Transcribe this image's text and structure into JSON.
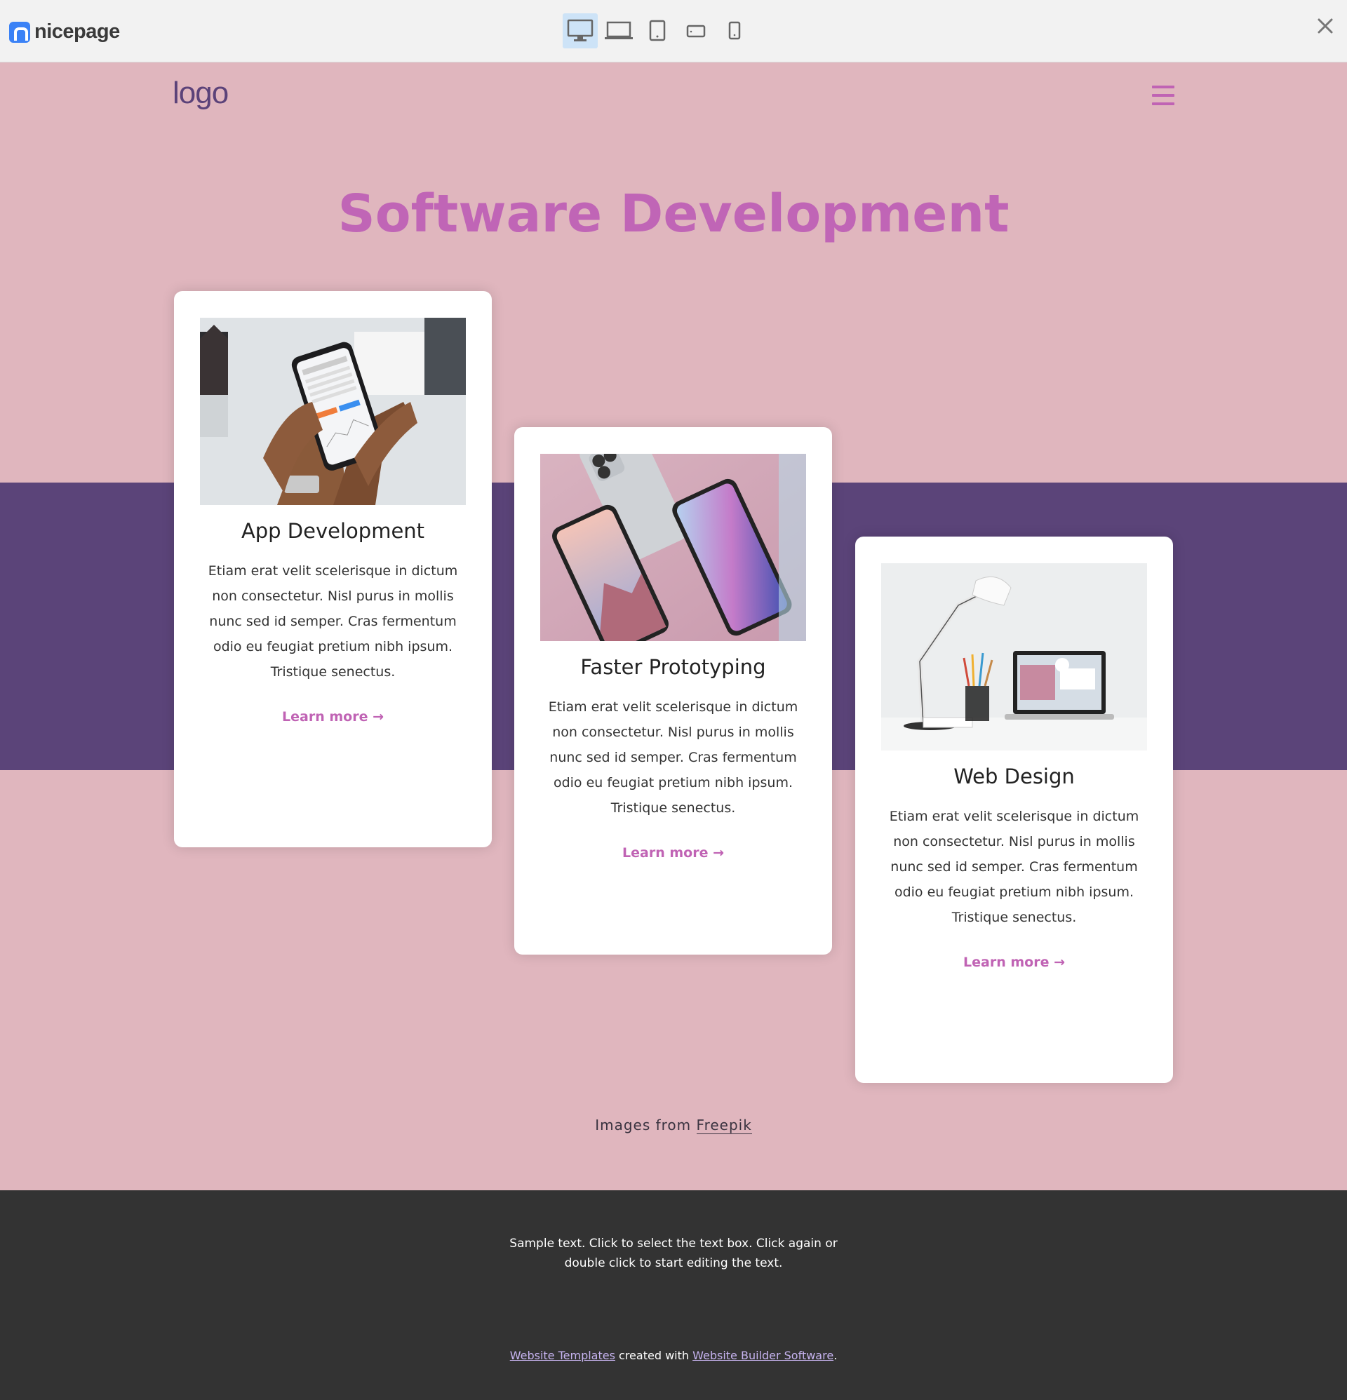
{
  "toolbar": {
    "brand": "nicepage",
    "devices": [
      "desktop",
      "laptop",
      "tablet",
      "phone-landscape",
      "phone"
    ],
    "active_device": "desktop"
  },
  "site": {
    "logo": "logo",
    "title": "Software Development"
  },
  "cards": [
    {
      "title": "App Development",
      "text": "Etiam erat velit scelerisque in dictum non consectetur. Nisl purus in mollis nunc sed id semper. Cras fermentum odio eu feugiat pretium nibh ipsum. Tristique senectus.",
      "link": "Learn more →"
    },
    {
      "title": "Faster Prototyping",
      "text": "Etiam erat velit scelerisque in dictum non consectetur. Nisl purus in mollis nunc sed id semper. Cras fermentum odio eu feugiat pretium nibh ipsum. Tristique senectus.",
      "link": "Learn more →"
    },
    {
      "title": "Web Design",
      "text": "Etiam erat velit scelerisque in dictum non consectetur. Nisl purus in mollis nunc sed id semper. Cras fermentum odio eu feugiat pretium nibh ipsum. Tristique senectus.",
      "link": "Learn more →"
    }
  ],
  "credit": {
    "prefix": "Images from",
    "link": "Freepik"
  },
  "footer": {
    "text": "Sample text. Click to select the text box. Click again or double click to start editing the text.",
    "link1": "Website Templates",
    "middle": "created with",
    "link2": "Website Builder Software",
    "suffix": "."
  },
  "colors": {
    "page_bg": "#e0b6be",
    "band": "#5b4479",
    "accent": "#c065b6",
    "footer_bg": "#333333"
  }
}
